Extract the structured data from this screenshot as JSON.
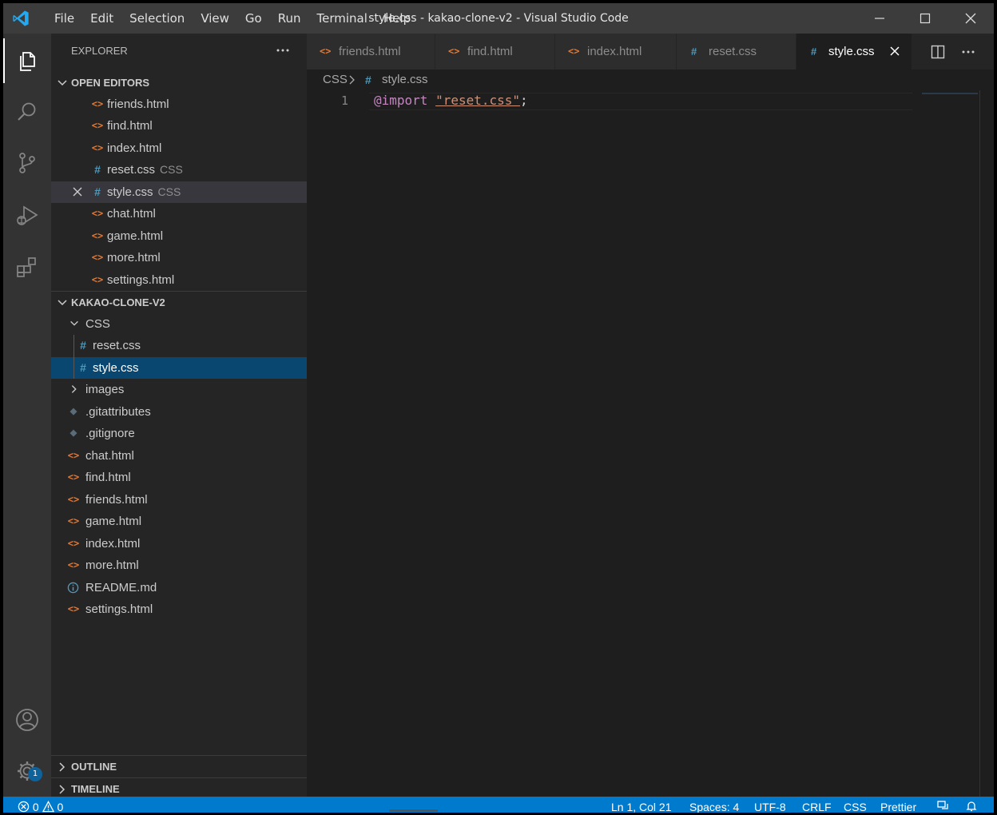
{
  "titlebar": {
    "menu": [
      "File",
      "Edit",
      "Selection",
      "View",
      "Go",
      "Run",
      "Terminal",
      "Help"
    ],
    "title": "style.css - kakao-clone-v2 - Visual Studio Code"
  },
  "activity": {
    "settings_badge": "1"
  },
  "sidebar": {
    "header": "EXPLORER",
    "open_editors": {
      "title": "OPEN EDITORS",
      "items": [
        {
          "name": "friends.html",
          "icon": "html-icon"
        },
        {
          "name": "find.html",
          "icon": "html-icon"
        },
        {
          "name": "index.html",
          "icon": "html-icon"
        },
        {
          "name": "reset.css",
          "desc": "CSS",
          "icon": "css-icon"
        },
        {
          "name": "style.css",
          "desc": "CSS",
          "icon": "css-icon"
        },
        {
          "name": "chat.html",
          "icon": "html-icon"
        },
        {
          "name": "game.html",
          "icon": "html-icon"
        },
        {
          "name": "more.html",
          "icon": "html-icon"
        },
        {
          "name": "settings.html",
          "icon": "html-icon"
        }
      ]
    },
    "project": {
      "title": "KAKAO-CLONE-V2",
      "items": [
        {
          "name": "CSS",
          "icon": "chevron-down-icon"
        },
        {
          "name": "reset.css",
          "icon": "css-icon"
        },
        {
          "name": "style.css",
          "icon": "css-icon"
        },
        {
          "name": "images",
          "icon": "chevron-right-icon"
        },
        {
          "name": ".gitattributes",
          "icon": "git-icon"
        },
        {
          "name": ".gitignore",
          "icon": "git-icon"
        },
        {
          "name": "chat.html",
          "icon": "html-icon"
        },
        {
          "name": "find.html",
          "icon": "html-icon"
        },
        {
          "name": "friends.html",
          "icon": "html-icon"
        },
        {
          "name": "game.html",
          "icon": "html-icon"
        },
        {
          "name": "index.html",
          "icon": "html-icon"
        },
        {
          "name": "more.html",
          "icon": "html-icon"
        },
        {
          "name": "README.md",
          "icon": "info-icon"
        },
        {
          "name": "settings.html",
          "icon": "html-icon"
        }
      ]
    },
    "outline": "OUTLINE",
    "timeline": "TIMELINE"
  },
  "tabs": [
    {
      "name": "friends.html",
      "icon": "html-icon"
    },
    {
      "name": "find.html",
      "icon": "html-icon"
    },
    {
      "name": "index.html",
      "icon": "html-icon"
    },
    {
      "name": "reset.css",
      "icon": "css-icon"
    },
    {
      "name": "style.css",
      "icon": "css-icon",
      "active": true
    }
  ],
  "breadcrumb": {
    "folder": "CSS",
    "file": "style.css"
  },
  "editor": {
    "line_number": "1",
    "keyword": "@import",
    "string": "\"reset.css\"",
    "punct": ";"
  },
  "status": {
    "errors": "0",
    "warnings": "0",
    "position": "Ln 1, Col 21",
    "spaces": "Spaces: 4",
    "encoding": "UTF-8",
    "eol": "CRLF",
    "language": "CSS",
    "formatter": "Prettier"
  },
  "colors": {
    "accent": "#007acc",
    "html": "#e37933",
    "css": "#519aba",
    "selection": "#094771"
  }
}
